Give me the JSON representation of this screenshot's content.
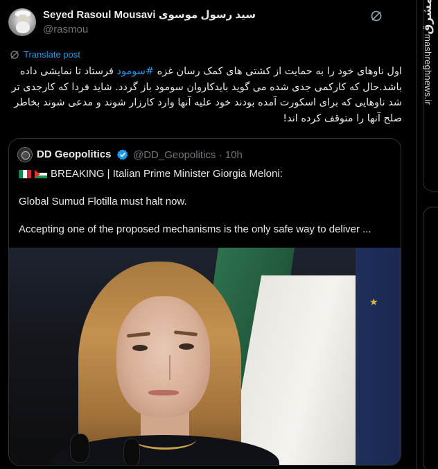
{
  "author": {
    "display_name": "Seyed Rasoul Mousavi سید رسول موسوی",
    "handle": "@rasmou"
  },
  "translate": {
    "label": "Translate post"
  },
  "tweet": {
    "line1_before": "اول ناوهای خود را به حمایت از کشتی های کمک رسان غزه ",
    "hashtag": "#سومود",
    "line1_after": " فرستاد تا نمایشی داده باشد.حال که کارکمی جدی شده می گوید بایدکاروان سومود باز گردد. شاید فردا که کارجدی تر شد ناوهایی که برای اسکورت آمده بودند خود علیه آنها وارد کارزار شوند و مدعی شوند بخاطر صلح آنها را متوقف کرده اند!"
  },
  "quote": {
    "name": "DD Geopolitics",
    "handle_time": "@DD_Geopolitics · 10h",
    "line1": "BREAKING | Italian Prime Minister Giorgia Meloni:",
    "line2": "Global Sumud Flotilla must halt now.",
    "line3": "Accepting one of the proposed mechanisms is the only safe way to deliver ..."
  },
  "watermark": {
    "logo_text": "مشرق",
    "site": "mashreghnews.ir"
  },
  "icons": {
    "grok": "grok-icon",
    "translate": "translate-icon",
    "verified": "verified-badge-icon"
  },
  "colors": {
    "background": "#000000",
    "text": "#e7e9ea",
    "muted": "#71767b",
    "link": "#1d9bf0",
    "border": "#2f3336"
  }
}
